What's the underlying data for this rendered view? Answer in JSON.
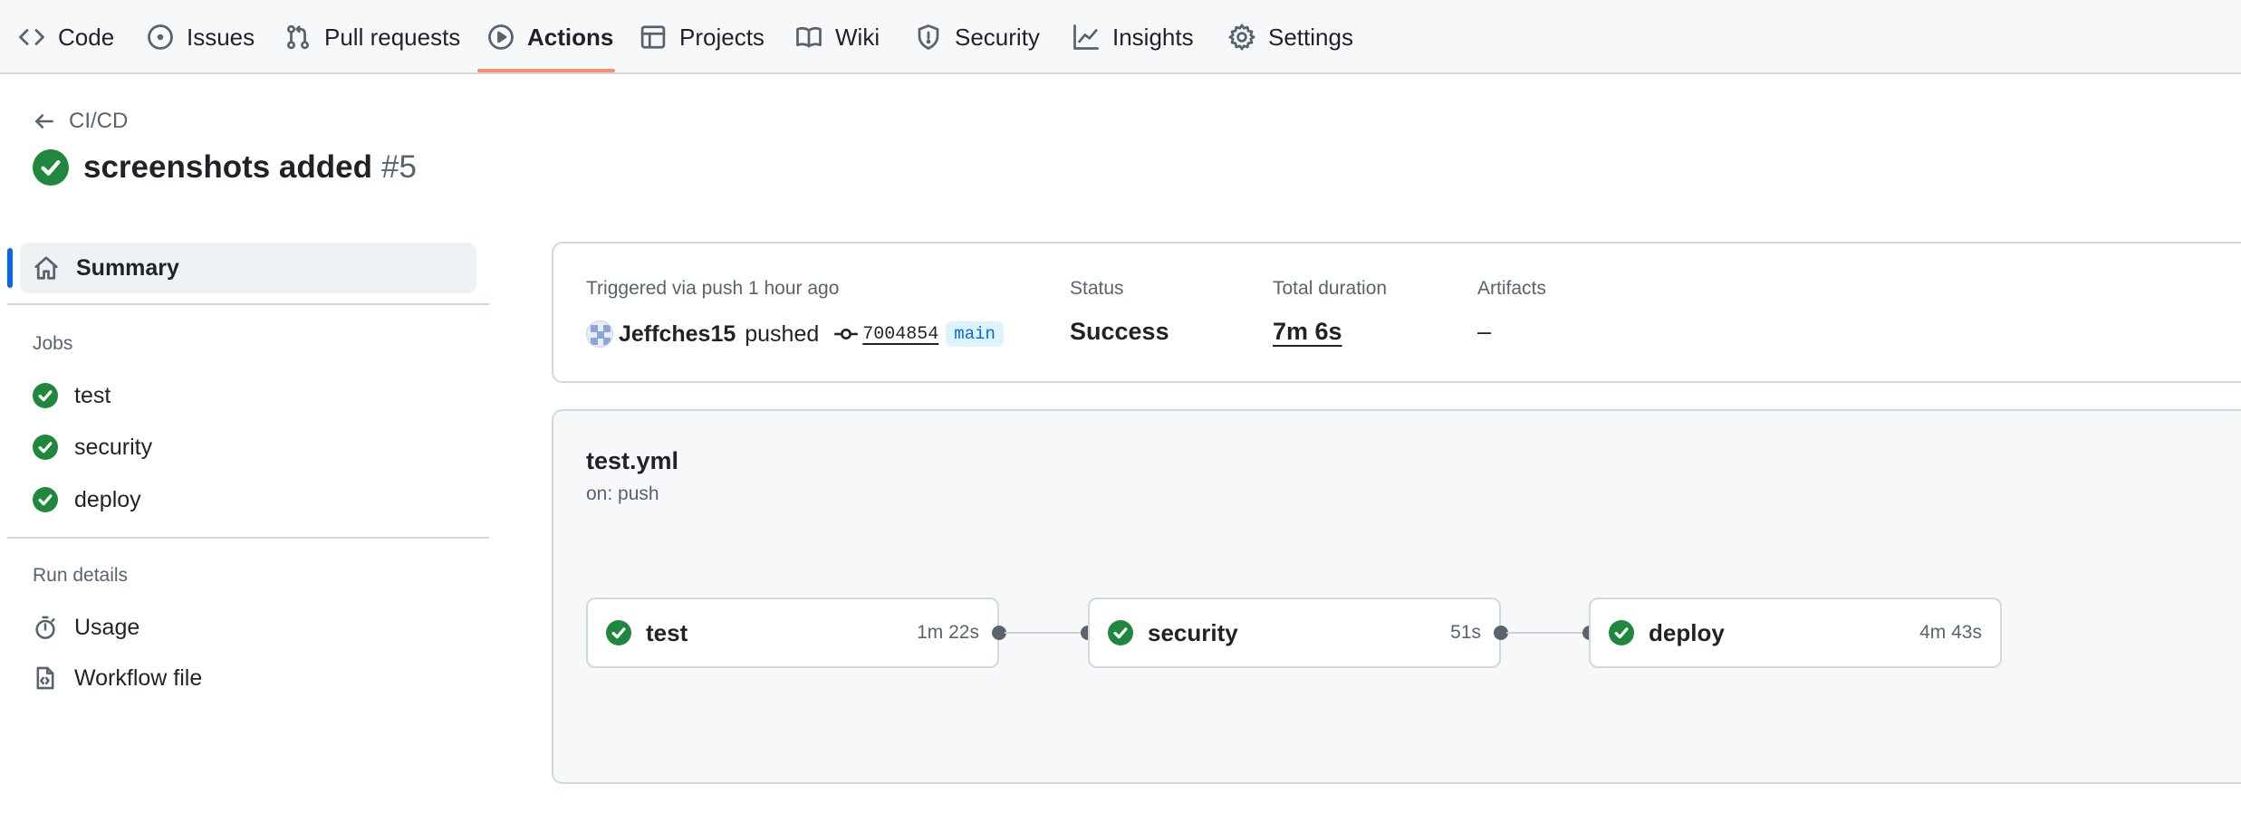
{
  "repo_nav": {
    "tabs": [
      {
        "label": "Code",
        "icon": "code-icon"
      },
      {
        "label": "Issues",
        "icon": "issue-opened-icon"
      },
      {
        "label": "Pull requests",
        "icon": "git-pull-request-icon"
      },
      {
        "label": "Actions",
        "icon": "play-icon",
        "active": true
      },
      {
        "label": "Projects",
        "icon": "table-icon"
      },
      {
        "label": "Wiki",
        "icon": "book-icon"
      },
      {
        "label": "Security",
        "icon": "shield-icon"
      },
      {
        "label": "Insights",
        "icon": "graph-icon"
      },
      {
        "label": "Settings",
        "icon": "gear-icon"
      }
    ]
  },
  "header": {
    "back_label": "CI/CD",
    "title": "screenshots added",
    "run_number": "#5",
    "status_icon": "check-circle-fill-icon"
  },
  "sidebar": {
    "summary_label": "Summary",
    "jobs_heading": "Jobs",
    "jobs": [
      {
        "label": "test",
        "status": "success"
      },
      {
        "label": "security",
        "status": "success"
      },
      {
        "label": "deploy",
        "status": "success"
      }
    ],
    "run_details_heading": "Run details",
    "details": [
      {
        "label": "Usage",
        "icon": "stopwatch-icon"
      },
      {
        "label": "Workflow file",
        "icon": "file-code-icon"
      }
    ]
  },
  "summary": {
    "trigger_label": "Triggered via push 1 hour ago",
    "actor": "Jeffches15",
    "action": "pushed",
    "commit_sha": "7004854",
    "branch": "main",
    "status_label": "Status",
    "status_value": "Success",
    "duration_label": "Total duration",
    "duration_value": "7m 6s",
    "artifacts_label": "Artifacts",
    "artifacts_value": "–"
  },
  "workflow": {
    "file": "test.yml",
    "trigger": "on: push",
    "jobs": [
      {
        "name": "test",
        "duration": "1m 22s"
      },
      {
        "name": "security",
        "duration": "51s"
      },
      {
        "name": "deploy",
        "duration": "4m 43s"
      }
    ]
  },
  "colors": {
    "success": "#1f883d",
    "accent": "#0969da",
    "tab_underline": "#fd8c73",
    "border": "#d1d9e0",
    "muted_text": "#59636e"
  }
}
